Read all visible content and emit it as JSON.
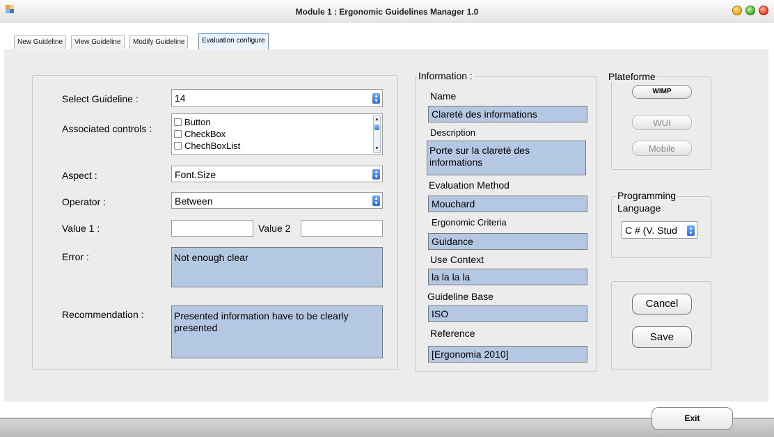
{
  "window": {
    "title": "Module 1 : Ergonomic Guidelines Manager 1.0"
  },
  "tabs": [
    "New Guideline",
    "View Guideline",
    "Modify Guideline",
    "Evaluation configure"
  ],
  "form": {
    "select_guideline_label": "Select Guideline :",
    "select_guideline_value": "14",
    "associated_controls_label": "Associated controls :",
    "associated_controls_items": [
      "Button",
      "CheckBox",
      "ChechBoxList"
    ],
    "aspect_label": "Aspect :",
    "aspect_value": "Font.Size",
    "operator_label": "Operator :",
    "operator_value": "Between",
    "value1_label": "Value 1 :",
    "value1_value": "",
    "value2_label": "Value 2",
    "value2_value": "",
    "error_label": "Error :",
    "error_value": "Not enough clear",
    "recommendation_label": "Recommendation :",
    "recommendation_value": "Presented information have to be clearly presented"
  },
  "information": {
    "legend": "Information :",
    "name_label": "Name",
    "name_value": "Clareté des informations",
    "description_label": "Description",
    "description_value": "Porte sur la clareté des informations",
    "evaluation_method_label": "Evaluation Method",
    "evaluation_method_value": "Mouchard",
    "ergonomic_criteria_label": "Ergonomic Criteria",
    "ergonomic_criteria_value": "Guidance",
    "use_context_label": "Use Context",
    "use_context_value": "la la la la",
    "guideline_base_label": "Guideline Base",
    "guideline_base_value": "ISO",
    "reference_label": "Reference",
    "reference_value": "[Ergonomia 2010]"
  },
  "plateforme": {
    "legend": "Plateforme",
    "buttons": [
      "WIMP",
      "WUI",
      "Mobile"
    ]
  },
  "programming": {
    "legend_line1": "Programming",
    "legend_line2": "Language",
    "value": "C # (V. Stud"
  },
  "actions": {
    "cancel": "Cancel",
    "save": "Save"
  },
  "footer": {
    "exit": "Exit"
  }
}
